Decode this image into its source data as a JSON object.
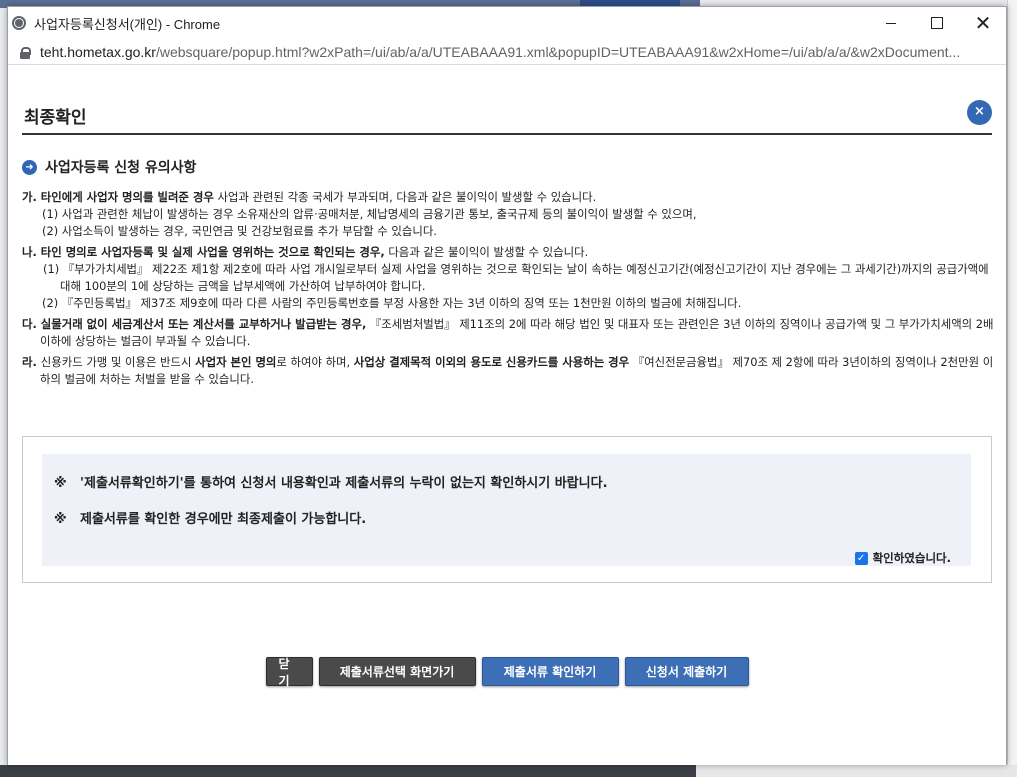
{
  "window": {
    "title": "사업자등록신청서(개인) - Chrome",
    "url_host": "teht.hometax.go.kr",
    "url_path": "/websquare/popup.html?w2xPath=/ui/ab/a/a/UTEABAAA91.xml&popupID=UTEABAAA91&w2xHome=/ui/ab/a/a/&w2xDocument..."
  },
  "dialog": {
    "title": "최종확인",
    "close_label": "×",
    "section_title": "사업자등록 신청 유의사항"
  },
  "notes": {
    "ga": {
      "head_bold": "가. 타인에게 사업자 명의를 빌려준 경우",
      "head_rest": " 사업과 관련된 각종 국세가 부과되며, 다음과 같은 불이익이 발생할 수 있습니다.",
      "item1": "(1) 사업과 관련한 체납이 발생하는 경우 소유재산의 압류·공매처분, 체납명세의 금융기관 통보, 출국규제 등의 불이익이 발생할 수 있으며,",
      "item2": "(2) 사업소득이 발생하는 경우, 국민연금 및 건강보험료를 추가 부담할 수 있습니다."
    },
    "na": {
      "head_bold": "나. 타인 명의로 사업자등록 및 실제 사업을 영위하는 것으로 확인되는 경우,",
      "head_rest": " 다음과 같은 불이익이 발생할 수 있습니다.",
      "item1": "(1) 『부가가치세법』 제22조 제1항 제2호에 따라 사업 개시일로부터 실제 사업을 영위하는 것으로 확인되는 날이 속하는 예정신고기간(예정신고기간이 지난 경우에는 그 과세기간)까지의 공급가액에 대해 100분의 1에 상당하는 금액을 납부세액에 가산하여 납부하여야 합니다.",
      "item2": "(2) 『주민등록법』 제37조 제9호에 따라 다른 사람의 주민등록번호를 부정 사용한 자는 3년 이하의 징역 또는 1천만원 이하의 벌금에 처해집니다."
    },
    "da": {
      "head_bold": "다. 실물거래 없이 세금계산서 또는 계산서를 교부하거나 발급받는 경우,",
      "head_rest": " 『조세범처벌법』 제11조의 2에 따라 해당 법인 및 대표자 또는 관련인은 3년 이하의 징역이나 공급가액 및 그 부가가치세액의 2배 이하에 상당하는 벌금이 부과될 수 있습니다."
    },
    "ra": {
      "head_a": "라. ",
      "head_b": "신용카드 가맹 및 이용은 반드시 ",
      "head_c": "사업자 본인 명의",
      "head_d": "로 하여야 하며, ",
      "head_e": "사업상 결제목적 이외의 용도로 신용카드를 사용하는 경우",
      "head_f": " 『여신전문금융법』 제70조 제 2항에 따라 3년이하의 징역이나 2천만원 이하의 벌금에 처하는 처벌을 받을 수 있습니다."
    }
  },
  "confirm": {
    "mark": "※",
    "line1": "'제출서류확인하기'를 통하여 신청서 내용확인과 제출서류의 누락이 없는지 확인하시기 바랍니다.",
    "line2": "제출서류를 확인한 경우에만 최종제출이 가능합니다.",
    "checkbox_label": "확인하였습니다.",
    "checked": true
  },
  "buttons": {
    "close": "닫기",
    "go_select": "제출서류선택 화면가기",
    "check_docs": "제출서류 확인하기",
    "submit": "신청서 제출하기"
  }
}
